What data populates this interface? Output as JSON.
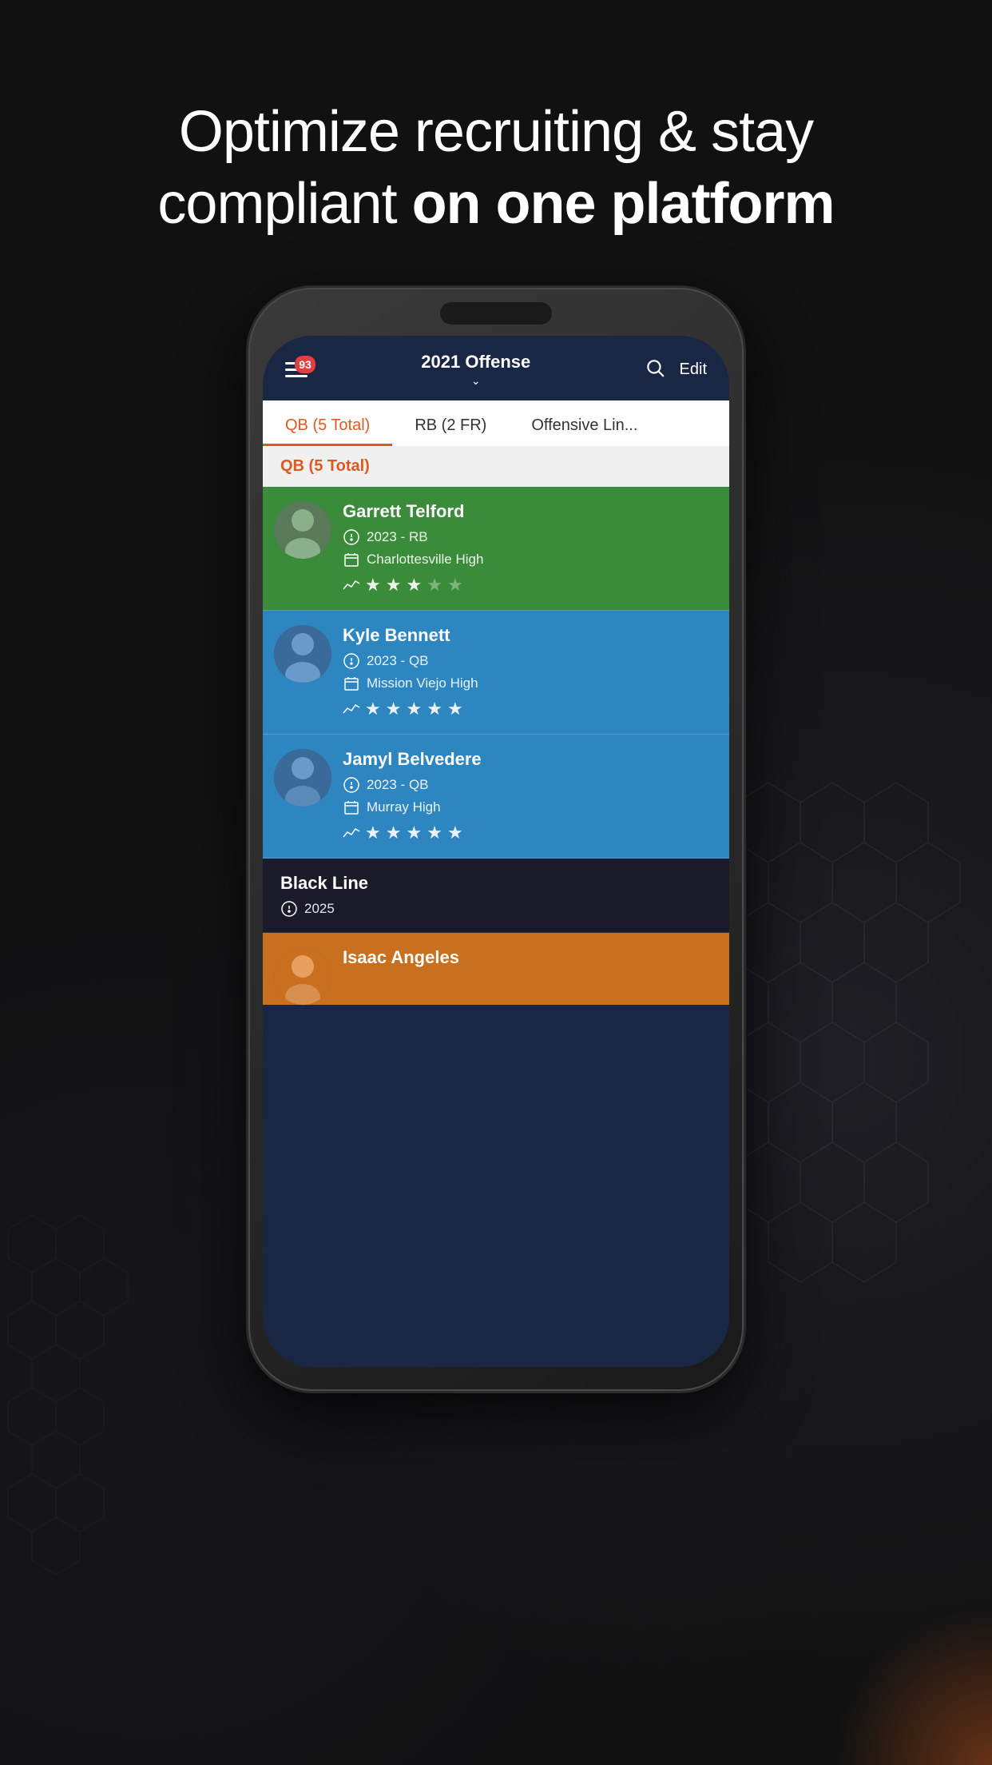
{
  "hero": {
    "line1": "Optimize recruiting & stay",
    "line2": "compliant ",
    "line2_bold": "on one platform"
  },
  "app": {
    "header": {
      "title": "2021 Offense",
      "notification_count": "93",
      "edit_label": "Edit"
    },
    "tabs": [
      {
        "label": "QB (5 Total)",
        "active": true
      },
      {
        "label": "RB (2 FR)",
        "active": false
      },
      {
        "label": "Offensive Lin...",
        "active": false
      }
    ],
    "section_label": "QB (5 Total)",
    "players": [
      {
        "id": 1,
        "name": "Garrett Telford",
        "year": "2023",
        "position": "RB",
        "school": "Charlottesville High",
        "stars_filled": 3,
        "stars_empty": 2,
        "color": "green"
      },
      {
        "id": 2,
        "name": "Kyle Bennett",
        "year": "2023",
        "position": "QB",
        "school": "Mission Viejo High",
        "stars_filled": 5,
        "stars_empty": 0,
        "color": "blue"
      },
      {
        "id": 3,
        "name": "Jamyl Belvedere",
        "year": "2023",
        "position": "QB",
        "school": "Murray High",
        "stars_filled": 5,
        "stars_empty": 0,
        "color": "blue"
      },
      {
        "id": 4,
        "name": "Black Line",
        "year": "2025",
        "position": "",
        "school": "",
        "color": "dark"
      },
      {
        "id": 5,
        "name": "Isaac Angeles",
        "year": "",
        "position": "",
        "school": "",
        "color": "orange"
      }
    ]
  }
}
